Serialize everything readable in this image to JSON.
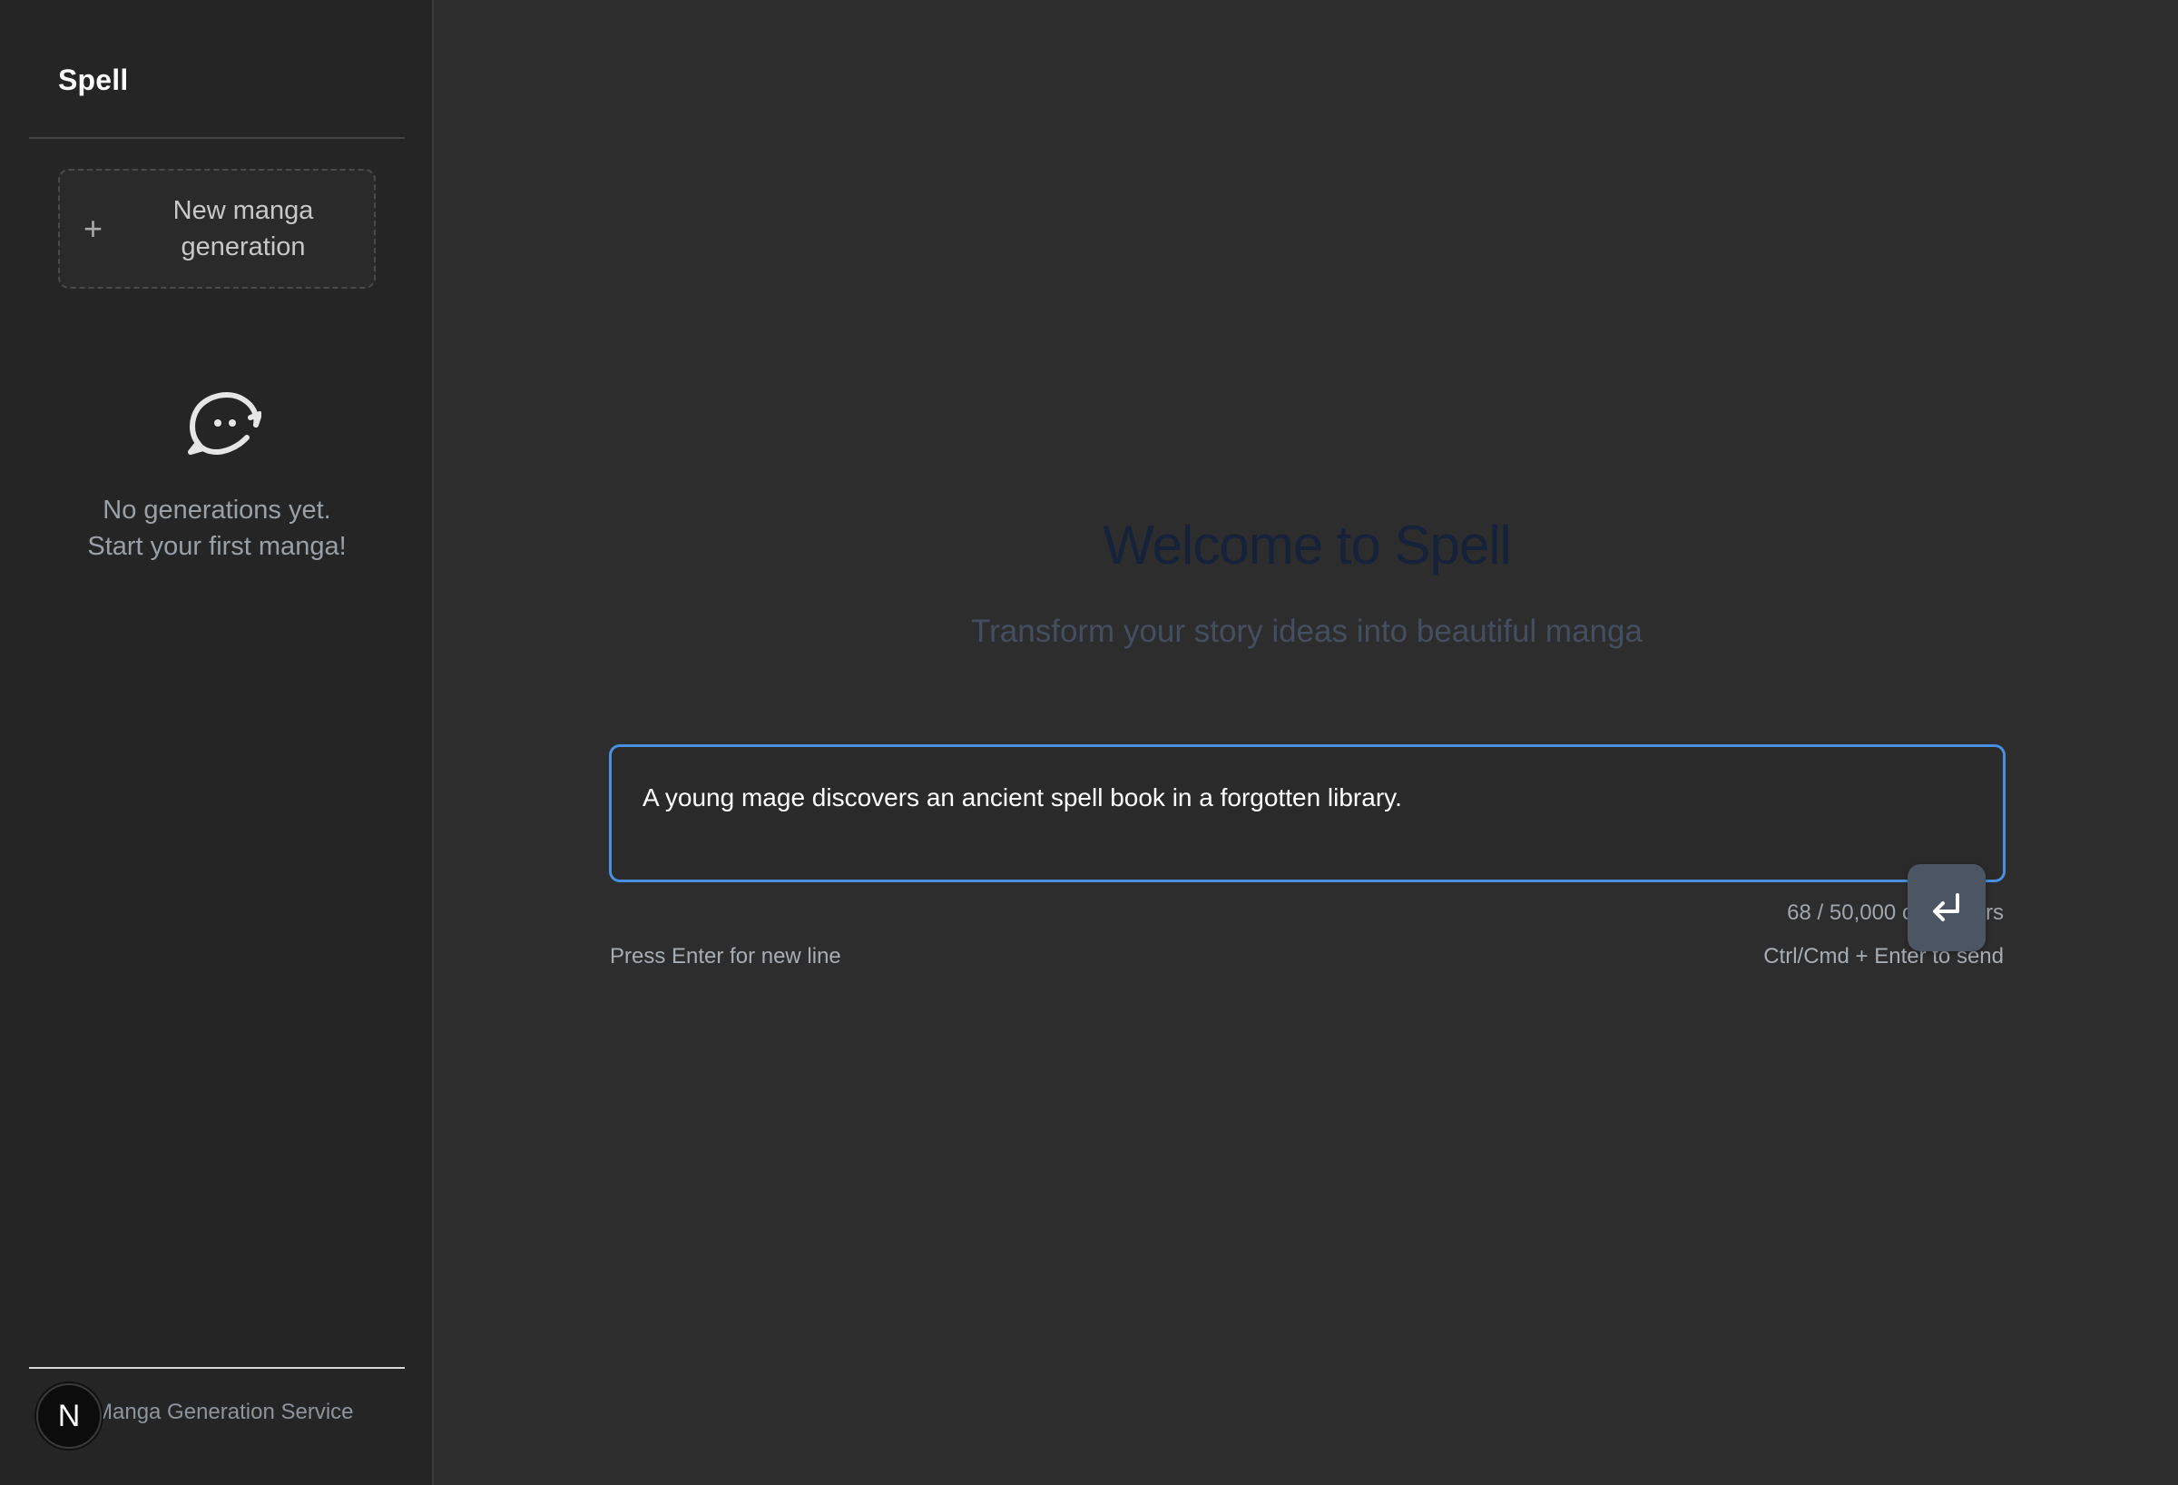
{
  "sidebar": {
    "brand": "Spell",
    "new_generation_label": "New manga generation",
    "new_generation_icon": "plus-icon",
    "empty_state": {
      "icon": "chat-bubble-face-icon",
      "line1": "No generations yet.",
      "line2": "Start your first manga!"
    },
    "footer": {
      "avatar_letter": "N",
      "text": "Manga Generation Service"
    }
  },
  "main": {
    "title": "Welcome to Spell",
    "subtitle": "Transform your story ideas into beautiful manga",
    "prompt": {
      "value": "A young mage discovers an ancient spell book in a forgotten library."
    },
    "char_count": "68 / 50,000 characters",
    "hint_left": "Press Enter for new line",
    "hint_right": "Ctrl/Cmd + Enter to send",
    "send_icon": "enter-return-icon"
  },
  "colors": {
    "sidebar_bg": "#252525",
    "main_bg": "#2d2d2d",
    "accent": "#4a90e2",
    "send_button": "#4b5563",
    "title": "#16213a",
    "subtitle": "#454e60"
  }
}
